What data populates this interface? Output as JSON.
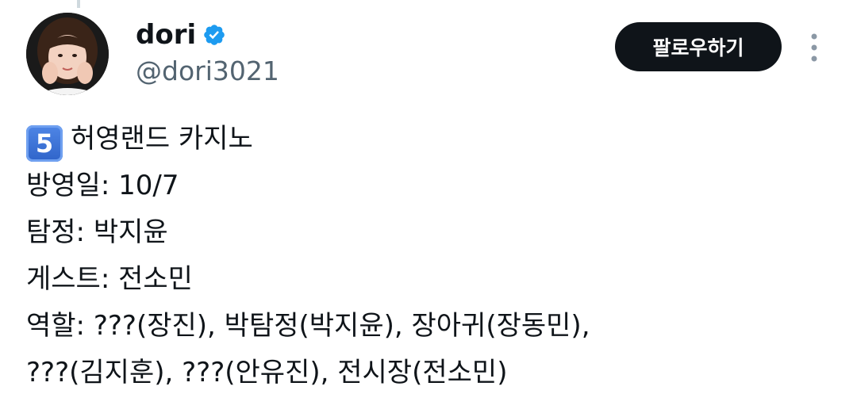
{
  "author": {
    "display_name": "dori",
    "handle": "@dori3021",
    "verified": true,
    "avatar_icon": "profile-photo"
  },
  "actions": {
    "follow_label": "팔로우하기",
    "more_icon": "more-vertical-icon"
  },
  "tweet": {
    "keycap_emoji": "5",
    "lines": [
      "허영랜드 카지노",
      "방영일: 10/7",
      "탐정: 박지윤",
      "게스트: 전소민",
      "역할: ???(장진), 박탐정(박지윤), 장아귀(장동민),",
      "???(김지훈), ???(안유진), 전시장(전소민)"
    ]
  },
  "colors": {
    "text_primary": "#0f1419",
    "text_secondary": "#536471",
    "verified_blue": "#1d9bf0",
    "button_bg": "#0f1419",
    "keycap_blue": "#3b73d9"
  }
}
